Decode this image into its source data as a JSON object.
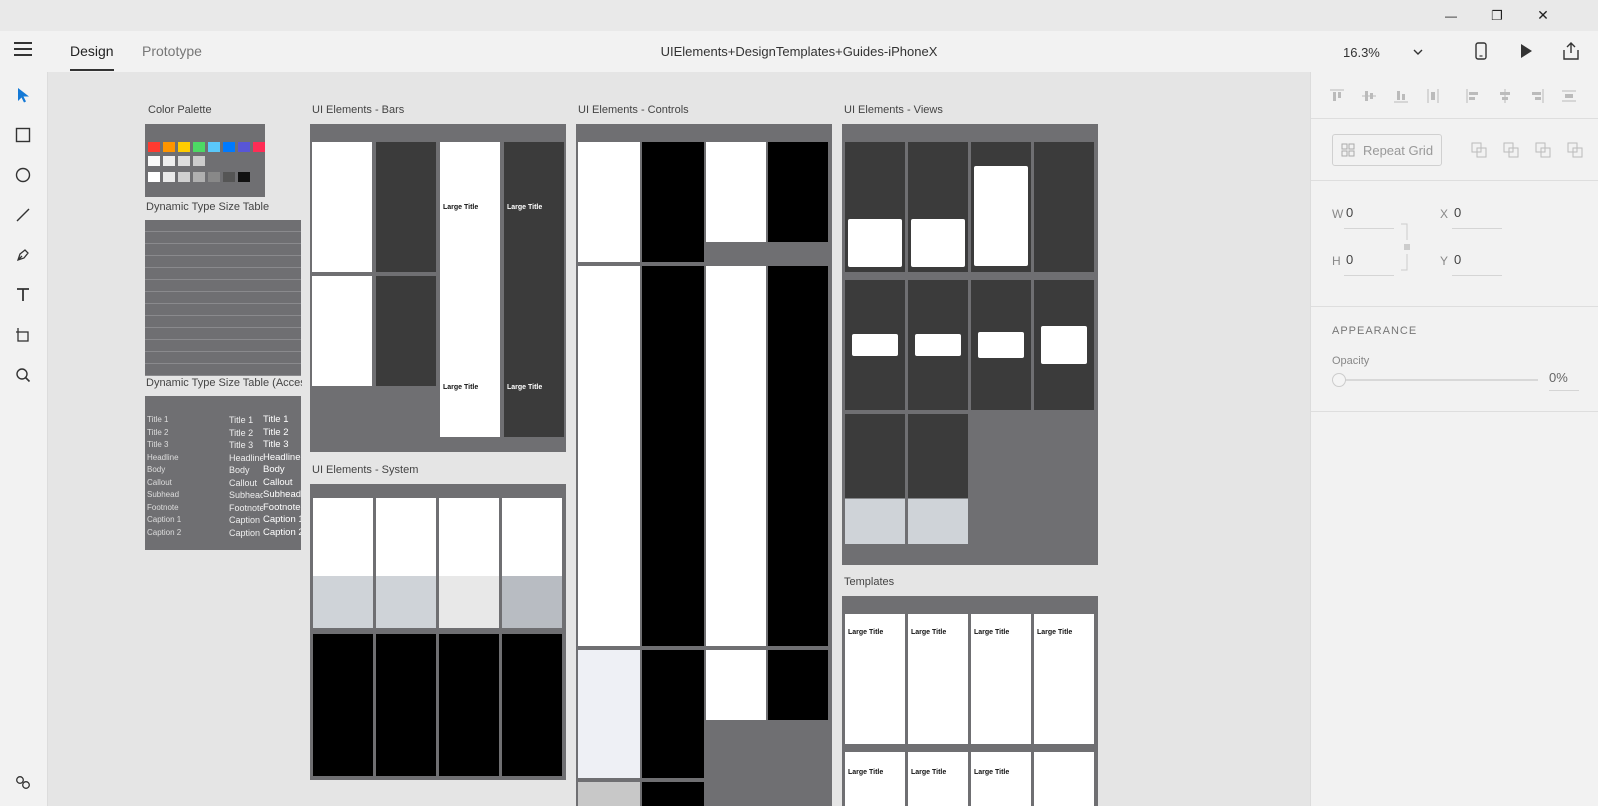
{
  "window": {
    "minimize_glyph": "—",
    "restore_glyph": "❐",
    "close_glyph": "✕"
  },
  "appbar": {
    "tabs": [
      {
        "label": "Design",
        "active": true
      },
      {
        "label": "Prototype",
        "active": false
      }
    ],
    "document_title": "UIElements+DesignTemplates+Guides-iPhoneX",
    "zoom": "16.3%",
    "icons": [
      "menu-icon",
      "device-preview-icon",
      "play-icon",
      "share-icon"
    ]
  },
  "tools": [
    "select-icon",
    "rectangle-icon",
    "ellipse-icon",
    "line-icon",
    "pen-icon",
    "text-icon",
    "artboard-icon",
    "zoom-icon",
    "plugins-icon"
  ],
  "artboards": [
    {
      "label": "Color Palette"
    },
    {
      "label": "Dynamic Type Size Table"
    },
    {
      "label": "Dynamic Type Size Table (Accessibility)"
    },
    {
      "label": "UI Elements - Bars"
    },
    {
      "label": "UI Elements - System"
    },
    {
      "label": "UI Elements - Controls"
    },
    {
      "label": "UI Elements - Views"
    },
    {
      "label": "Templates"
    }
  ],
  "artboard_text": {
    "large_title": "Large Title",
    "type_styles": [
      "Title 1",
      "Title 2",
      "Title 3",
      "Headline",
      "Body",
      "Callout",
      "Subhead",
      "Footnote",
      "Caption 1",
      "Caption 2"
    ]
  },
  "colors": {
    "palette": [
      "#ff3b30",
      "#ff9500",
      "#ffcc00",
      "#4cd964",
      "#5ac8fa",
      "#007aff",
      "#5856d6",
      "#ff2d55"
    ],
    "accent": "#007aff"
  },
  "panel": {
    "repeat_grid_label": "Repeat Grid",
    "w_label": "W",
    "w_value": "0",
    "h_label": "H",
    "h_value": "0",
    "x_label": "X",
    "x_value": "0",
    "y_label": "Y",
    "y_value": "0",
    "appearance_title": "APPEARANCE",
    "opacity_label": "Opacity",
    "opacity_value": "0%"
  }
}
